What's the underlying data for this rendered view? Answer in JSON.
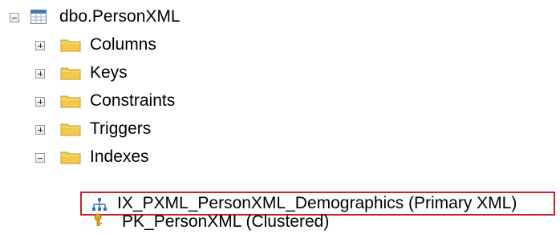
{
  "tree": {
    "table": {
      "label": "dbo.PersonXML",
      "icon": "table-icon",
      "expanded": true
    },
    "children": [
      {
        "label": "Columns",
        "icon": "folder-icon",
        "expanded": false
      },
      {
        "label": "Keys",
        "icon": "folder-icon",
        "expanded": false
      },
      {
        "label": "Constraints",
        "icon": "folder-icon",
        "expanded": false
      },
      {
        "label": "Triggers",
        "icon": "folder-icon",
        "expanded": false
      },
      {
        "label": "Indexes",
        "icon": "folder-icon",
        "expanded": true
      }
    ],
    "indexes": [
      {
        "label": "IX_PXML_PersonXML_Demographics (Primary XML)",
        "icon": "index-icon",
        "highlighted": true
      },
      {
        "label": "PK_PersonXML (Clustered)",
        "icon": "key-icon",
        "highlighted": false
      }
    ]
  },
  "colors": {
    "highlight_border": "#c0262c",
    "folder": "#f2c94c",
    "key": "#e0a422"
  }
}
